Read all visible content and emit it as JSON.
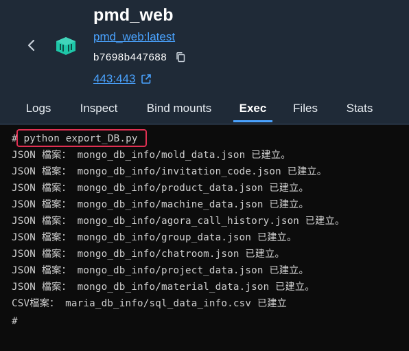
{
  "header": {
    "back_icon": "chevron-left-icon",
    "container_icon": "docker-container-icon",
    "title": "pmd_web",
    "image_link": "pmd_web:latest",
    "container_id": "b7698b447688",
    "copy_icon": "copy-icon",
    "port_link": "443:443",
    "external_link_icon": "external-link-icon"
  },
  "tabs": [
    {
      "label": "Logs"
    },
    {
      "label": "Inspect"
    },
    {
      "label": "Bind mounts"
    },
    {
      "label": "Exec"
    },
    {
      "label": "Files"
    },
    {
      "label": "Stats"
    }
  ],
  "active_tab": "Exec",
  "terminal": {
    "prompt": "#",
    "command": "python export_DB.py",
    "lines": [
      "JSON 檔案： mongo_db_info/mold_data.json 已建立。",
      "JSON 檔案： mongo_db_info/invitation_code.json 已建立。",
      "JSON 檔案： mongo_db_info/product_data.json 已建立。",
      "JSON 檔案： mongo_db_info/machine_data.json 已建立。",
      "JSON 檔案： mongo_db_info/agora_call_history.json 已建立。",
      "JSON 檔案： mongo_db_info/group_data.json 已建立。",
      "JSON 檔案： mongo_db_info/chatroom.json 已建立。",
      "JSON 檔案： mongo_db_info/project_data.json 已建立。",
      "JSON 檔案： mongo_db_info/material_data.json 已建立。",
      "CSV檔案： maria_db_info/sql_data_info.csv 已建立"
    ],
    "last_prompt": "#"
  },
  "colors": {
    "background": "#1f2a37",
    "accent": "#4aa3ff",
    "terminal_bg": "#0c0c0c",
    "terminal_text": "#cfcfcf",
    "highlight_box": "#e03052",
    "container_icon": "#1ec6a8"
  }
}
